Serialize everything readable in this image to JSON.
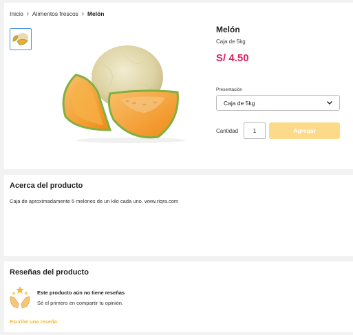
{
  "breadcrumb": {
    "items": [
      "Inicio",
      "Alimentos frescos",
      "Melón"
    ]
  },
  "product": {
    "title": "Melón",
    "subtitle": "Caja de 5kg",
    "price": "S/ 4.50",
    "image_subject": "cantaloupe-melon",
    "presentation_label": "Presentación",
    "presentation_selected": "Caja de 5kg",
    "quantity_label": "Cantidad",
    "quantity_value": "1",
    "add_button_label": "Agregar"
  },
  "about": {
    "title": "Acerca del producto",
    "text": "Caja de aproximadamente 5 melones de un kilo cada uno. www.riqra.com"
  },
  "reviews": {
    "title": "Reseñas del producto",
    "empty_title": "Este producto aún no tiene reseñas",
    "empty_subtitle": "Sé el primero en compartir tu opinión.",
    "write_link": "Escribe una reseña"
  },
  "colors": {
    "price": "#e0245e",
    "add_button": "#fdd98a",
    "link": "#f5b731",
    "thumb_border": "#4a90d9"
  }
}
